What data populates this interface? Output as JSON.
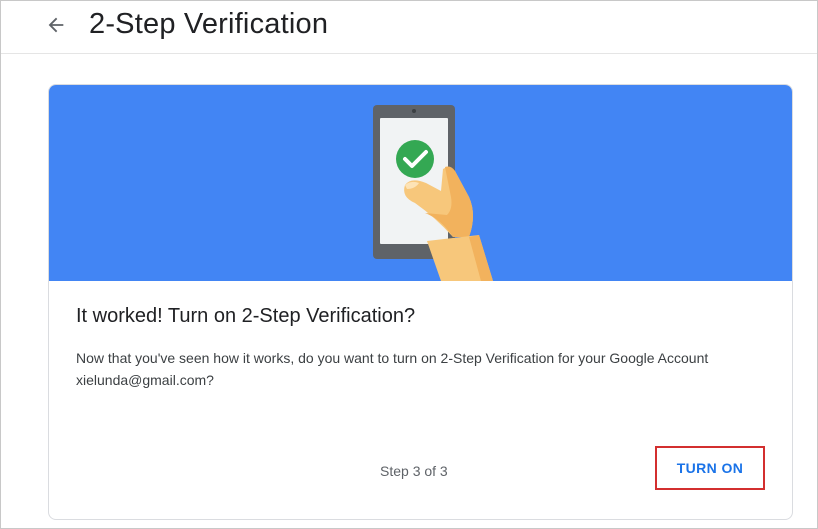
{
  "header": {
    "back_icon": "arrow-left-icon",
    "title": "2-Step Verification"
  },
  "card": {
    "illustration": "phone-check-illustration",
    "heading": "It worked! Turn on 2-Step Verification?",
    "body": "Now that you've seen how it works, do you want to turn on 2-Step Verification for your Google Account xielunda@gmail.com?",
    "step": "Step 3 of 3",
    "turn_on_label": "TURN ON"
  },
  "colors": {
    "hero_background": "#4285f4",
    "check_circle": "#34a853",
    "primary_action": "#1a73e8",
    "highlight_border": "#d32f2f"
  }
}
